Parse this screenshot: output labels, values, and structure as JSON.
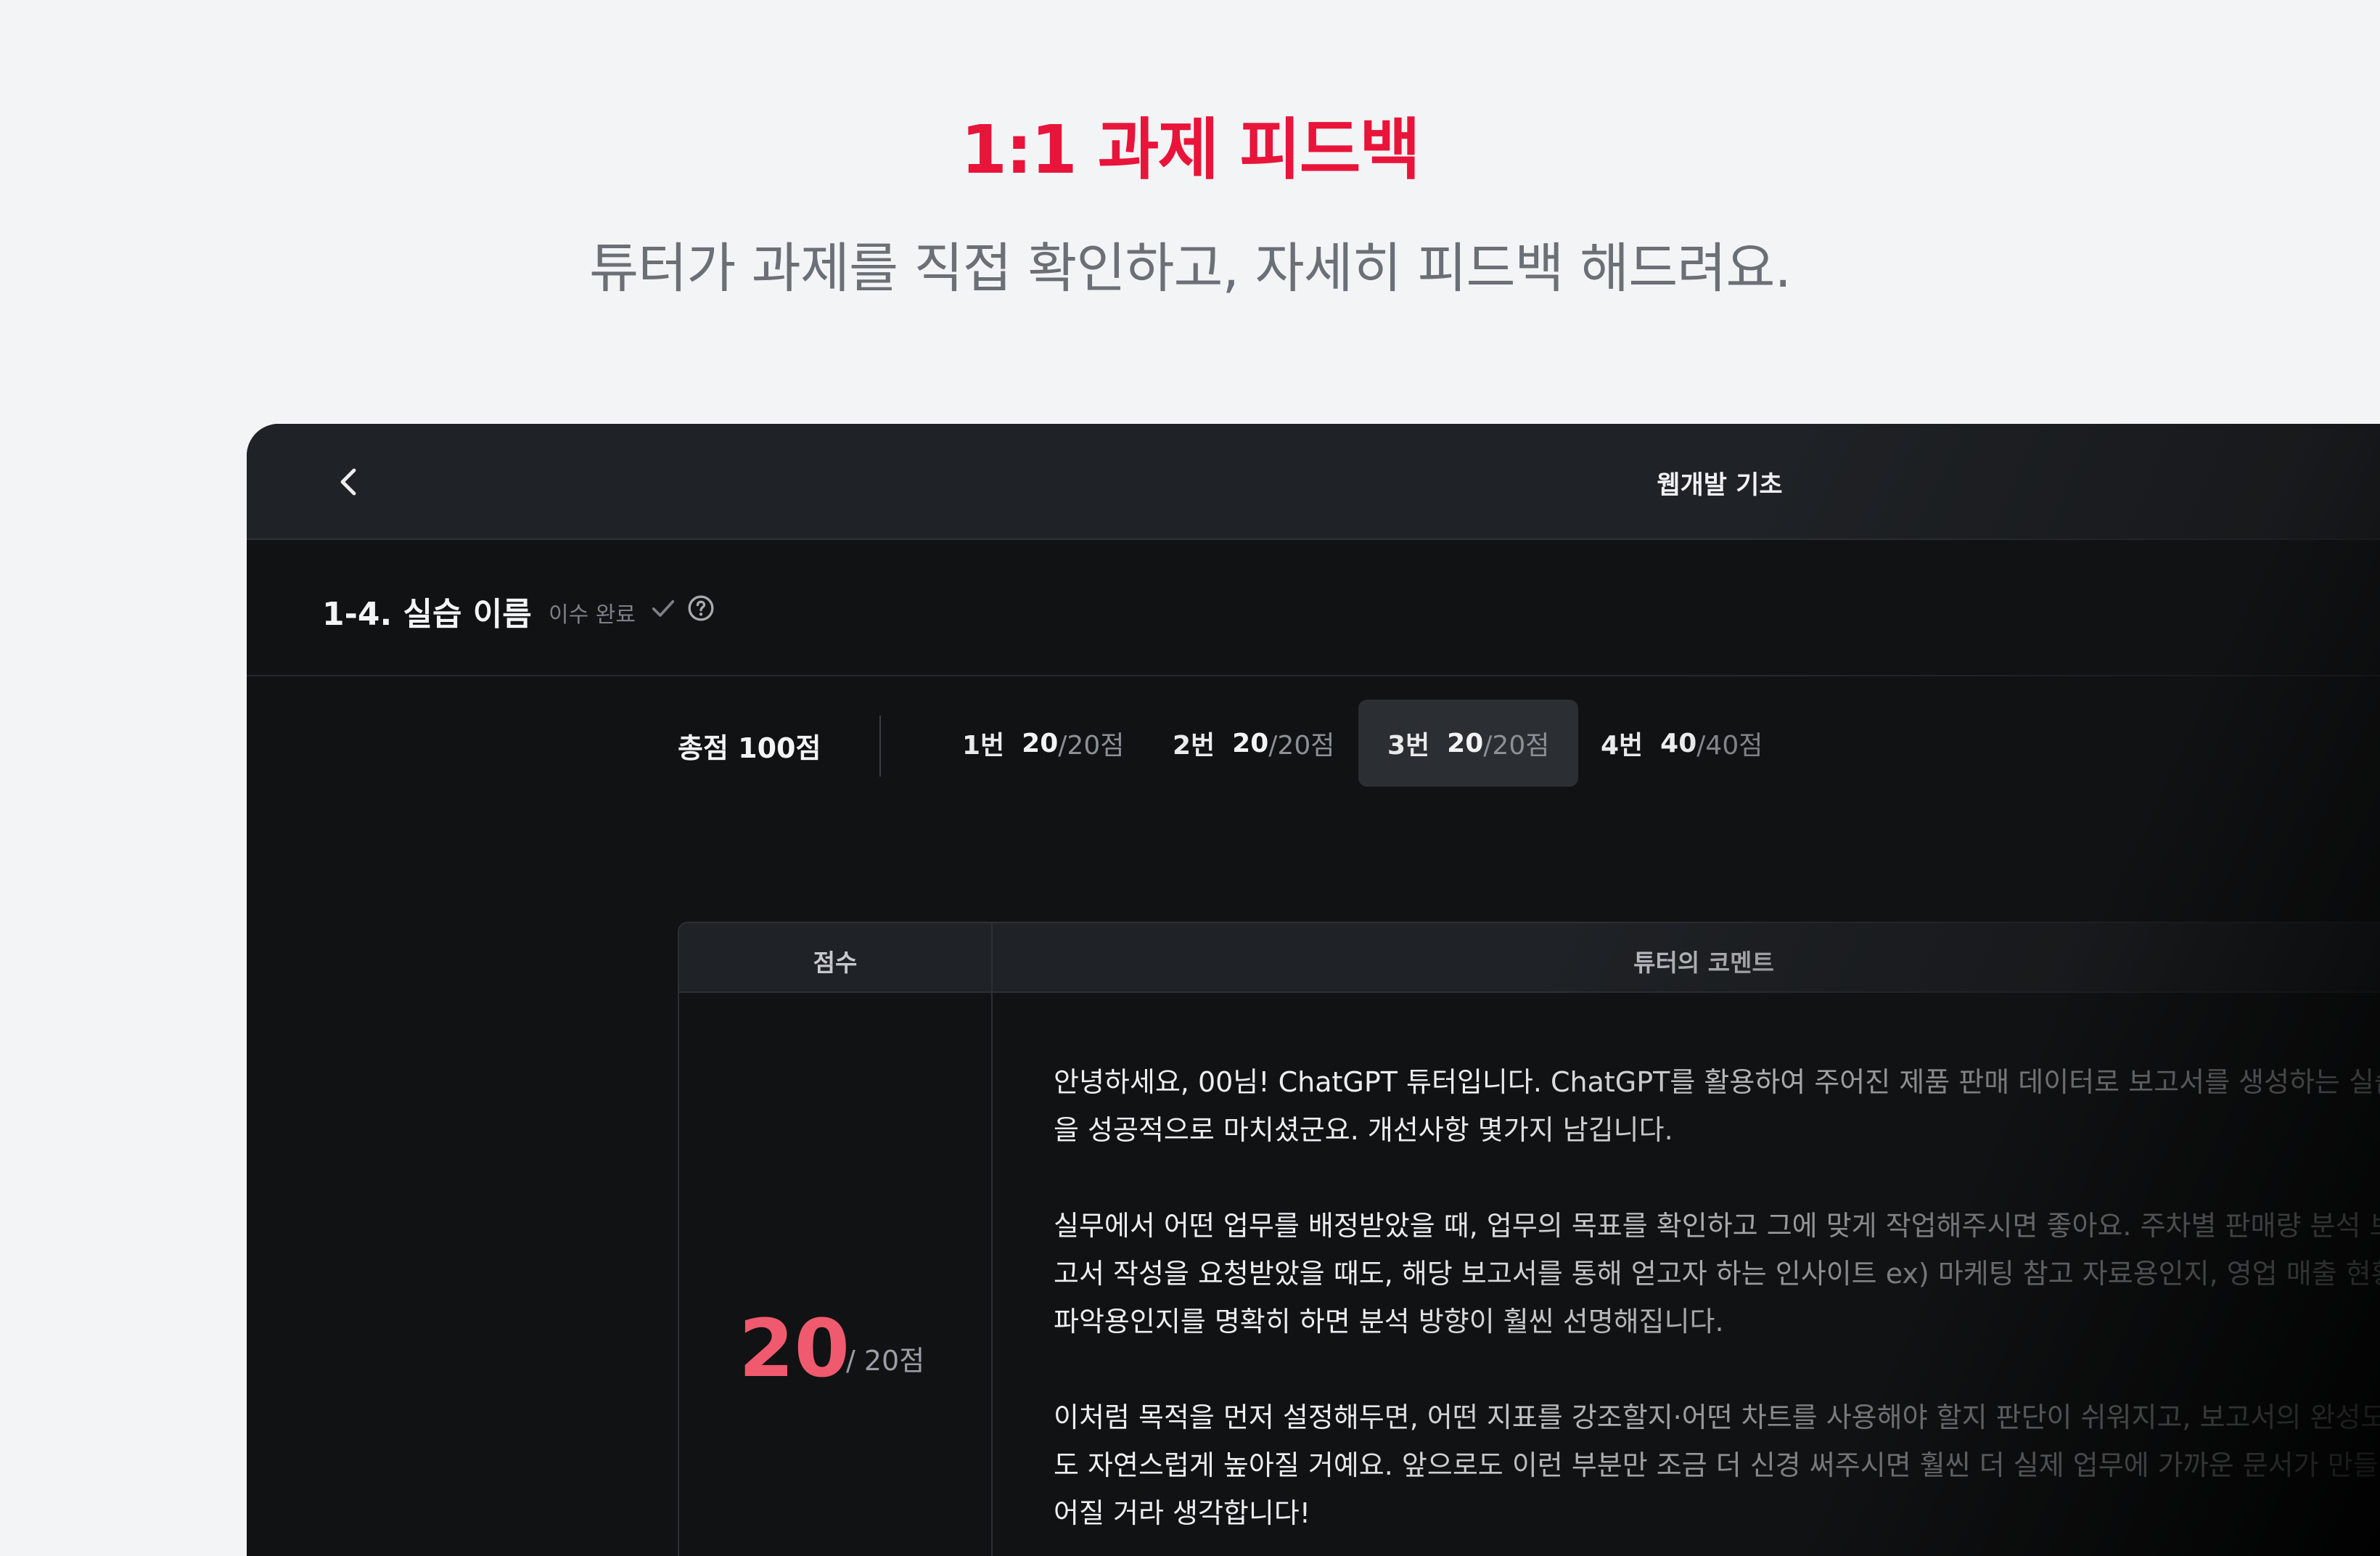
{
  "headline": "1:1 과제 피드백",
  "subheadline": "튜터가 과제를 직접 확인하고, 자세히 피드백 해드려요.",
  "topbar": {
    "title": "웹개발 기초",
    "back_icon": "chevron-left-icon"
  },
  "lesson": {
    "title": "1-4. 실습 이름",
    "status": "이수 완료",
    "check_icon": "check-icon",
    "help_icon": "question-circle-icon"
  },
  "score_bar": {
    "total": "총점 100점",
    "tabs": [
      {
        "label": "1번",
        "score": "20",
        "max": "/20점"
      },
      {
        "label": "2번",
        "score": "20",
        "max": "/20점"
      },
      {
        "label": "3번",
        "score": "20",
        "max": "/20점"
      },
      {
        "label": "4번",
        "score": "40",
        "max": "/40점"
      }
    ],
    "active_tab": "3번"
  },
  "table": {
    "headers": {
      "score": "점수",
      "comment": "튜터의 코멘트"
    },
    "score": {
      "value": "20",
      "max": "/ 20점"
    },
    "comment": [
      "안녕하세요, 00님! ChatGPT 튜터입니다. ChatGPT를 활용하여 주어진 제품 판매 데이터로 보고서를 생성하는 실습을 성공적으로 마치셨군요. 개선사항 몇가지 남깁니다.",
      "실무에서 어떤 업무를 배정받았을 때, 업무의 목표를 확인하고 그에 맞게 작업해주시면 좋아요. 주차별 판매량 분석 보고서 작성을 요청받았을 때도, 해당 보고서를 통해 얻고자 하는 인사이트 ex) 마케팅 참고 자료용인지, 영업 매출 현황 파악용인지를 명확히 하면 분석 방향이 훨씬 선명해집니다.",
      "이처럼 목적을 먼저 설정해두면, 어떤 지표를 강조할지·어떤 차트를 사용해야 할지 판단이 쉬워지고, 보고서의 완성도도 자연스럽게 높아질 거예요. 앞으로도 이런 부분만 조금 더 신경 써주시면 훨씬 더 실제 업무에 가까운 문서가 만들어질 거라 생각합니다!"
    ]
  },
  "colors": {
    "accent": "#e8143a",
    "score": "#f05a6e",
    "panel": "#111213"
  }
}
